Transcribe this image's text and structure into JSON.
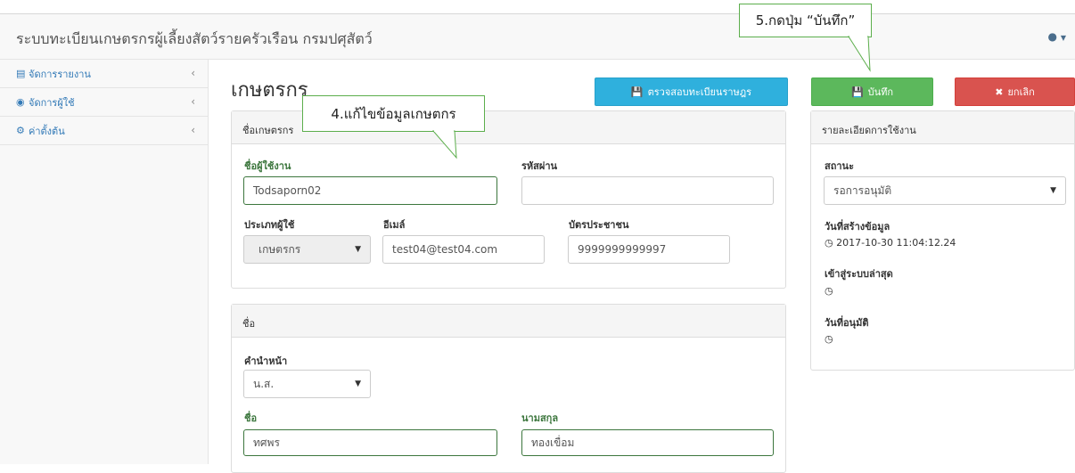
{
  "app": {
    "title": "ระบบทะเบียนเกษตรกรผู้เลี้ยงสัตว์รายครัวเรือน กรมปศุสัตว์",
    "user_icon": "user-icon"
  },
  "sidebar": {
    "items": [
      {
        "label": "จัดการรายงาน",
        "icon": "report-icon"
      },
      {
        "label": "จัดการผู้ใช้",
        "icon": "users-icon"
      },
      {
        "label": "ค่าตั้งต้น",
        "icon": "gears-icon"
      }
    ]
  },
  "page": {
    "title": "เกษตรกร"
  },
  "buttons": {
    "verify": "ตรวจสอบทะเบียนราษฎร",
    "save": "บันทึก",
    "cancel": "ยกเลิก"
  },
  "farmer_panel": {
    "heading": "ชื่อเกษตรกร",
    "username_label": "ชื่อผู้ใช้งาน",
    "username_value": "Todsaporn02",
    "password_label": "รหัสผ่าน",
    "password_value": "",
    "user_type_label": "ประเภทผู้ใช้",
    "user_type_value": "เกษตรกร",
    "email_label": "อีเมล์",
    "email_value": "test04@test04.com",
    "id_card_label": "บัตรประชาชน",
    "id_card_value": "9999999999997"
  },
  "name_panel": {
    "heading": "ชื่อ",
    "prefix_label": "คำนำหน้า",
    "prefix_value": "น.ส.",
    "first_name_label": "ชื่อ",
    "first_name_value": "ทศพร",
    "last_name_label": "นามสกุล",
    "last_name_value": "ทองเขื่อม"
  },
  "usage_panel": {
    "heading": "รายละเอียดการใช้งาน",
    "status_label": "สถานะ",
    "status_value": "รอการอนุมัติ",
    "created_label": "วันที่สร้างข้อมูล",
    "created_value": "2017-10-30 11:04:12.24",
    "last_login_label": "เข้าสู่ระบบล่าสุด",
    "last_login_value": "",
    "approved_label": "วันที่อนุมัติ",
    "approved_value": ""
  },
  "annotations": {
    "edit_note": "4.แก้ไขข้อมูลเกษตกร",
    "save_note": "5.กดปุ่ม “บันทึก”"
  },
  "colors": {
    "primary_link": "#337ab7",
    "info_button": "#2fb0dd",
    "success_button": "#5cb85c",
    "danger_button": "#d9534f",
    "valid_field": "#3c763d"
  }
}
